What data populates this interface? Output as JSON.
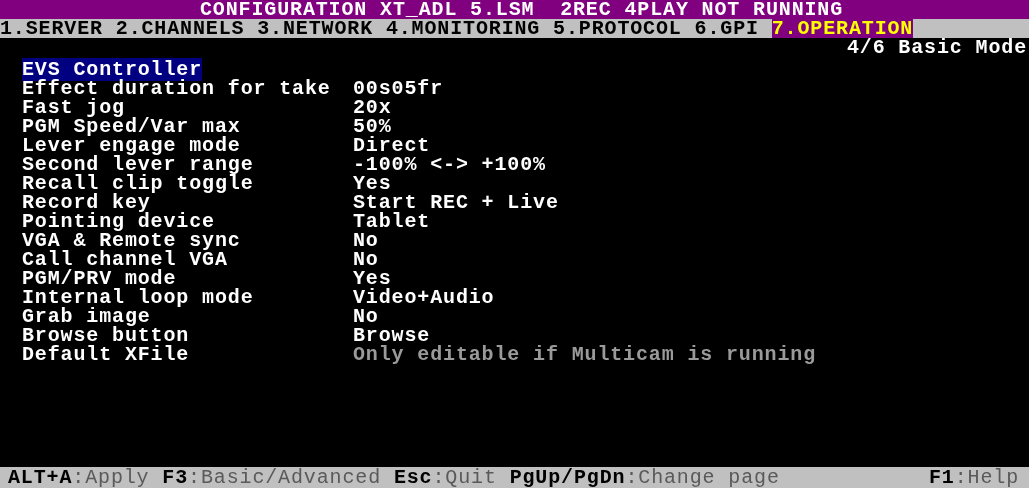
{
  "title": "CONFIGURATION XT_ADL 5.LSM  2REC 4PLAY NOT RUNNING",
  "tabs": [
    {
      "label": "1.SERVER",
      "selected": false
    },
    {
      "label": "2.CHANNELS",
      "selected": false
    },
    {
      "label": "3.NETWORK",
      "selected": false
    },
    {
      "label": "4.MONITORING",
      "selected": false
    },
    {
      "label": "5.PROTOCOL",
      "selected": false
    },
    {
      "label": "6.GPI",
      "selected": false
    },
    {
      "label": "7.OPERATION",
      "selected": true
    }
  ],
  "page_indicator": "4/6 Basic Mode",
  "section_header": "EVS Controller",
  "settings": [
    {
      "label": "Effect duration for take",
      "value": "00s05fr",
      "disabled": false
    },
    {
      "label": "Fast jog",
      "value": "20x",
      "disabled": false
    },
    {
      "label": "PGM Speed/Var max",
      "value": "50%",
      "disabled": false
    },
    {
      "label": "Lever engage mode",
      "value": "Direct",
      "disabled": false
    },
    {
      "label": "Second lever range",
      "value": "-100% <-> +100%",
      "disabled": false
    },
    {
      "label": "Recall clip toggle",
      "value": "Yes",
      "disabled": false
    },
    {
      "label": "Record key",
      "value": "Start REC + Live",
      "disabled": false
    },
    {
      "label": "Pointing device",
      "value": "Tablet",
      "disabled": false
    },
    {
      "label": "VGA & Remote sync",
      "value": "No",
      "disabled": false
    },
    {
      "label": "Call channel VGA",
      "value": "No",
      "disabled": false
    },
    {
      "label": "PGM/PRV mode",
      "value": "Yes",
      "disabled": false
    },
    {
      "label": "Internal loop mode",
      "value": "Video+Audio",
      "disabled": false
    },
    {
      "label": "Grab image",
      "value": "No",
      "disabled": false
    },
    {
      "label": "Browse button",
      "value": "Browse",
      "disabled": false
    },
    {
      "label": "Default XFile",
      "value": "Only editable if Multicam is running",
      "disabled": true
    }
  ],
  "shortcuts": [
    {
      "key": "ALT+A",
      "action": ":Apply"
    },
    {
      "key": "F3",
      "action": ":Basic/Advanced"
    },
    {
      "key": "Esc",
      "action": ":Quit"
    },
    {
      "key": "PgUp/PgDn",
      "action": ":Change page"
    }
  ],
  "help": {
    "key": "F1",
    "action": ":Help"
  }
}
